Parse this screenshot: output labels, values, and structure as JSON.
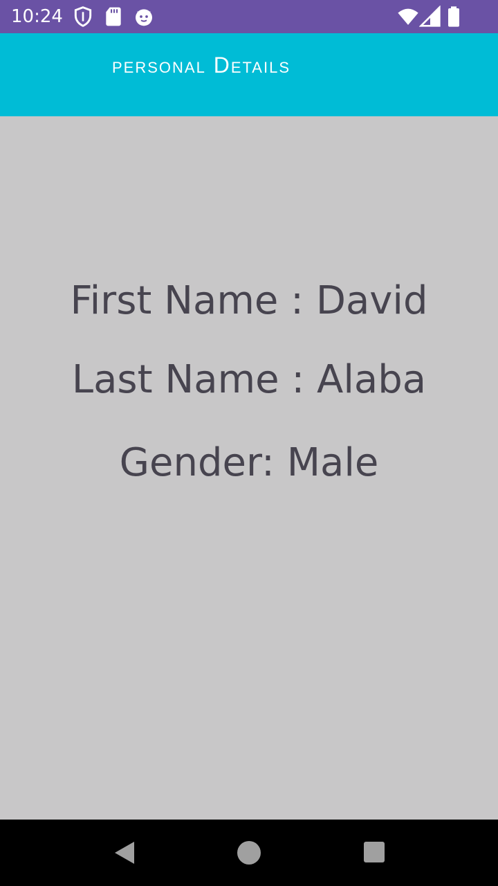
{
  "status_bar": {
    "time": "10:24",
    "icons": [
      "shield-icon",
      "sd-card-icon",
      "cat-face-icon",
      "wifi-icon",
      "signal-icon",
      "battery-icon"
    ],
    "background": "#6a52a5"
  },
  "app_bar": {
    "title": "personal Details",
    "background": "#00bcd6"
  },
  "details": {
    "first_name_line": "First Name : David",
    "last_name_line": "Last Name : Alaba",
    "gender_line": "Gender: Male",
    "text_color": "#47444f"
  },
  "nav_bar": {
    "buttons": [
      "back-icon",
      "home-icon",
      "recents-icon"
    ]
  }
}
